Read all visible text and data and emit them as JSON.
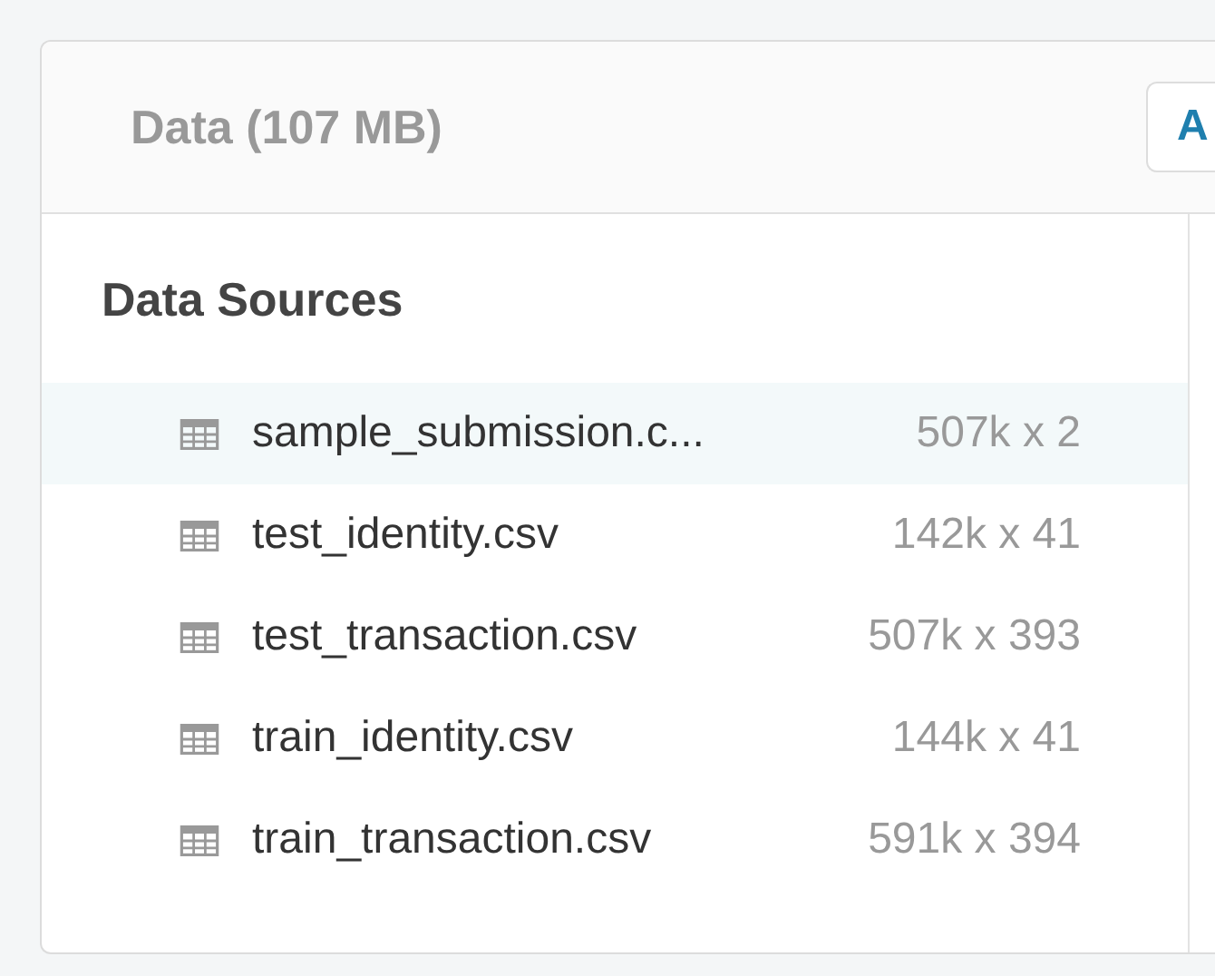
{
  "header": {
    "title": "Data (107 MB)",
    "button": "A"
  },
  "data_sources": {
    "heading": "Data Sources",
    "files": [
      {
        "name": "sample_submission.c...",
        "dims": "507k x 2",
        "selected": true
      },
      {
        "name": "test_identity.csv",
        "dims": "142k x 41",
        "selected": false
      },
      {
        "name": "test_transaction.csv",
        "dims": "507k x 393",
        "selected": false
      },
      {
        "name": "train_identity.csv",
        "dims": "144k x 41",
        "selected": false
      },
      {
        "name": "train_transaction.csv",
        "dims": "591k x 394",
        "selected": false
      }
    ]
  }
}
